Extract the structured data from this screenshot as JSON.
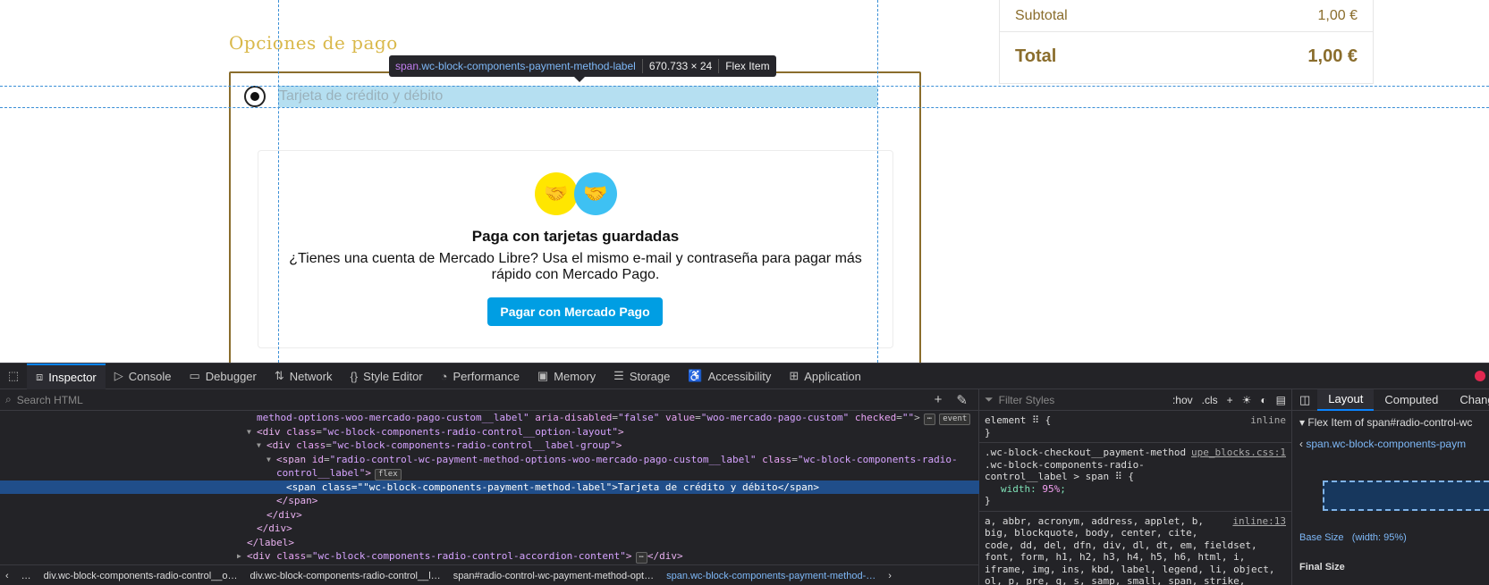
{
  "checkout": {
    "section_title": "Opciones de pago",
    "subtotal_label": "Subtotal",
    "subtotal_value": "1,00 €",
    "total_label": "Total",
    "total_value": "1,00 €",
    "payment_method_label": "Tarjeta de crédito y débito",
    "mp_title": "Paga con tarjetas guardadas",
    "mp_text": "¿Tienes una cuenta de Mercado Libre? Usa el mismo e-mail y contraseña para pagar más rápido con Mercado Pago.",
    "mp_button": "Pagar con Mercado Pago"
  },
  "tooltip": {
    "tag": "span",
    "class": ".wc-block-components-payment-method-label",
    "size": "670.733 × 24",
    "kind": "Flex Item"
  },
  "devtools": {
    "tabs": [
      "Inspector",
      "Console",
      "Debugger",
      "Network",
      "Style Editor",
      "Performance",
      "Memory",
      "Storage",
      "Accessibility",
      "Application"
    ],
    "search_placeholder": "Search HTML",
    "filter_placeholder": "Filter Styles",
    "hov": ":hov",
    "cls": ".cls",
    "code": {
      "l1_a": "method-options-woo-mercado-pago-custom__label\"",
      "l1_b": "aria-disabled",
      "l1_c": "\"false\"",
      "l1_d": "value",
      "l1_e": "\"woo-mercado-pago-custom\"",
      "l1_f": "checked",
      "l1_g": "\"\"",
      "l1_badge": "event",
      "l2": "\"wc-block-components-radio-control__option-layout\"",
      "l3": "\"wc-block-components-radio-control__label-group\"",
      "l4_id": "\"radio-control-wc-payment-method-options-woo-mercado-pago-custom__label\"",
      "l4_class": "\"wc-block-components-radio-",
      "l5": "control__label\"",
      "l5_badge": "flex",
      "l6_class": "\"wc-block-components-payment-method-label\"",
      "l6_text": "Tarjeta de crédito y débito",
      "l11": "\"wc-block-components-radio-control-accordion-content\""
    },
    "breadcrumbs": [
      "div.wc-block-components-radio-control__o…",
      "div.wc-block-components-radio-control__l…",
      "span#radio-control-wc-payment-method-opt…",
      "span.wc-block-components-payment-method-…"
    ],
    "styles": {
      "element_selector": "element",
      "element_src": "inline",
      "rule2_sel1": ".wc-block-checkout__payment-method",
      "rule2_sel2": ".wc-block-components-radio-",
      "rule2_sel3": "control__label > span",
      "rule2_src": "upe_blocks.css:1",
      "rule2_prop": "width",
      "rule2_val": "95%",
      "rule3_l1": "a, abbr, acronym, address, applet, b,",
      "rule3_l2": "big, blockquote, body, center, cite,",
      "rule3_l3": "code, dd, del, dfn, div, dl, dt, em, fieldset,",
      "rule3_l4": "font, form, h1, h2, h3, h4, h5, h6, html, i,",
      "rule3_l5": "iframe, img, ins, kbd, label, legend, li, object,",
      "rule3_l6": "ol, p, pre, q, s, samp, small, span, strike,",
      "rule3_src": "inline:13"
    },
    "layout": {
      "tabs": [
        "Layout",
        "Computed",
        "Change"
      ],
      "flex_item_header": "Flex Item of span#radio-control-wc",
      "flex_item_link": "span.wc-block-components-paym",
      "base_size_label": "Base Size",
      "base_size_value": "(width: 95%)",
      "final_size_label": "Final Size"
    }
  }
}
